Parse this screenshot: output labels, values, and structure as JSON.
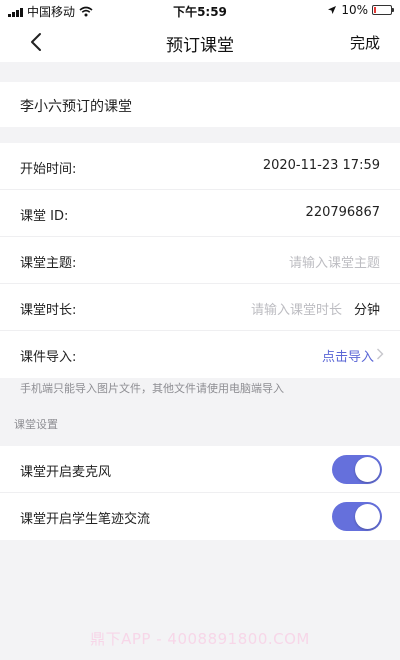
{
  "status_bar": {
    "carrier": "中国移动",
    "time": "下午5:59",
    "battery_percent": "10%",
    "battery_level": 0.1,
    "battery_color": "#e53935"
  },
  "nav": {
    "back_icon": "chevron-left-icon",
    "title": "预订课堂",
    "done_label": "完成"
  },
  "classroom_owner": "李小六预订的课堂",
  "fields": {
    "start_time_label": "开始时间:",
    "start_time_value": "2020-11-23 17:59",
    "class_id_label": "课堂 ID:",
    "class_id_value": "220796867",
    "topic_label": "课堂主题:",
    "topic_placeholder": "请输入课堂主题",
    "duration_label": "课堂时长:",
    "duration_placeholder": "请输入课堂时长",
    "duration_unit": "分钟",
    "courseware_label": "课件导入:",
    "courseware_action": "点击导入"
  },
  "hint": "手机端只能导入图片文件，其他文件请使用电脑端导入",
  "settings": {
    "section_title": "课堂设置",
    "microphone_label": "课堂开启麦克风",
    "microphone_on": true,
    "annotation_label": "课堂开启学生笔迹交流",
    "annotation_on": true,
    "toggle_color": "#6570dc"
  },
  "watermark": "鼎下APP - 4008891800.COM",
  "colors": {
    "accent": "#5b67d6",
    "background": "#f3f3f5"
  }
}
